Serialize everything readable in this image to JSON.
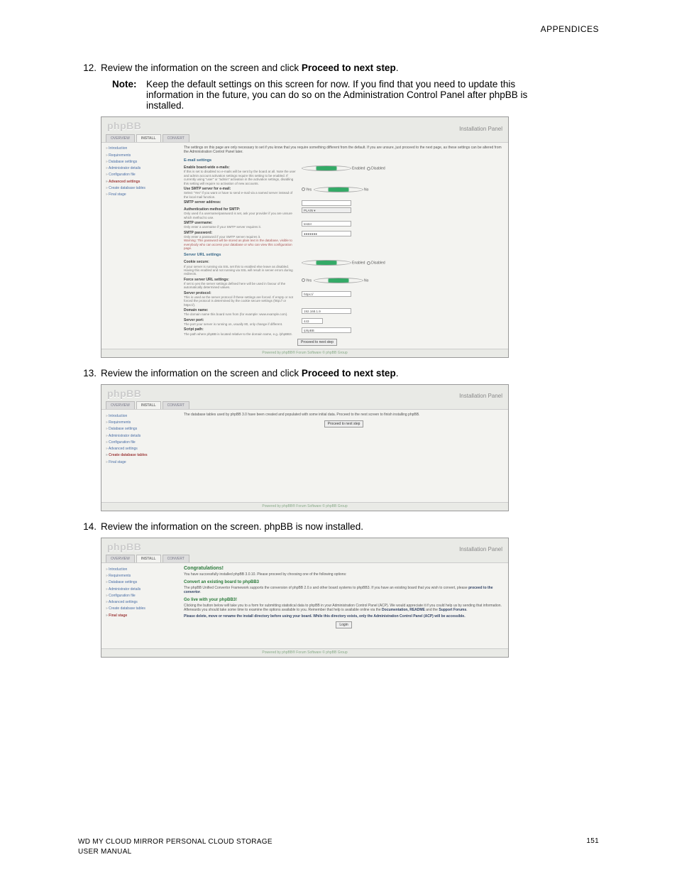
{
  "header": {
    "appendices": "APPENDICES"
  },
  "steps": {
    "s12": {
      "num": "12.",
      "text_a": "Review the information on the screen and click ",
      "bold": "Proceed to next step",
      "text_b": "."
    },
    "note": {
      "label": "Note:",
      "body": "Keep the default settings on this screen for now. If you find that you need to update this information in the future, you can do so on the Administration Control Panel after phpBB is installed."
    },
    "s13": {
      "num": "13.",
      "text_a": "Review the information on the screen and click ",
      "bold": "Proceed to next step",
      "text_b": "."
    },
    "s14": {
      "num": "14.",
      "text": "Review the information on the screen. phpBB is now installed."
    }
  },
  "screenshots": {
    "common": {
      "logo": "phpBB",
      "panel_title": "Installation Panel",
      "tabs": [
        "OVERVIEW",
        "INSTALL",
        "CONVERT"
      ],
      "footer": "Powered by phpBB® Forum Software © phpBB Group"
    },
    "s1": {
      "side": [
        {
          "label": "Introduction"
        },
        {
          "label": "Requirements"
        },
        {
          "label": "Database settings"
        },
        {
          "label": "Administrator details"
        },
        {
          "label": "Configuration file"
        },
        {
          "label": "Advanced settings",
          "active": true
        },
        {
          "label": "Create database tables"
        },
        {
          "label": "Final stage"
        }
      ],
      "intro": "The settings on this page are only necessary to set if you know that you require something different from the default. If you are unsure, just proceed to the next page, as these settings can be altered from the Administration Control Panel later.",
      "email_head": "E-mail settings",
      "fields": {
        "boardwide": {
          "title": "Enable board-wide e-mails:",
          "desc": "If this is set to disabled no e-mails will be sent by the board at all. Note the user and admin account activation settings require this setting to be enabled. If currently using \"user\" or \"admin\" activation in the activation settings, disabling this setting will require no activation of new accounts.",
          "opt1": "Enabled",
          "opt2": "Disabled"
        },
        "usesmtp": {
          "title": "Use SMTP server for e-mail:",
          "desc": "Select \"Yes\" if you want or have to send e-mail via a named server instead of the local mail function.",
          "opt1": "Yes",
          "opt2": "No"
        },
        "smtpaddr": {
          "title": "SMTP server address:",
          "val": ""
        },
        "auth": {
          "title": "Authentication method for SMTP:",
          "desc": "Only used if a username/password is set, ask your provider if you are unsure which method to use.",
          "val": "PLAIN"
        },
        "smtpuser": {
          "title": "SMTP username:",
          "desc": "Only enter a username if your SMTP server requires it.",
          "val": "tester"
        },
        "smtppass": {
          "title": "SMTP password:",
          "desc": "Only enter a password if your SMTP server requires it.",
          "warn": "Warning: This password will be stored as plain text in the database, visible to everybody who can access your database or who can view this configuration page.",
          "val": "●●●●●●●"
        }
      },
      "url_head": "Server URL settings",
      "urlfields": {
        "cookie": {
          "title": "Cookie secure:",
          "desc": "If your server is running via SSL set this to enabled else leave as disabled. Having this enabled and not running via SSL will result in server errors during redirects.",
          "opt1": "Enabled",
          "opt2": "Disabled"
        },
        "force": {
          "title": "Force server URL settings:",
          "desc": "If set to yes the server settings defined here will be used in favour of the automatically determined values.",
          "opt1": "Yes",
          "opt2": "No"
        },
        "proto": {
          "title": "Server protocol:",
          "desc": "This is used as the server protocol if these settings are forced. If empty or not forced the protocol is determined by the cookie secure settings (http:// or https://).",
          "val": "https://"
        },
        "domain": {
          "title": "Domain name:",
          "desc": "The domain name this board runs from (for example: www.example.com).",
          "val": "192.168.1.9"
        },
        "port": {
          "title": "Server port:",
          "desc": "The port your server is running on, usually 80, only change if different.",
          "val": "443"
        },
        "script": {
          "title": "Script path:",
          "desc": "The path where phpBB is located relative to the domain name, e.g. /phpBB3.",
          "val": "/phpBB"
        }
      },
      "proceed": "Proceed to next step"
    },
    "s2": {
      "side": [
        {
          "label": "Introduction"
        },
        {
          "label": "Requirements"
        },
        {
          "label": "Database settings"
        },
        {
          "label": "Administrator details"
        },
        {
          "label": "Configuration file"
        },
        {
          "label": "Advanced settings"
        },
        {
          "label": "Create database tables",
          "active": true
        },
        {
          "label": "Final stage"
        }
      ],
      "msg": "The database tables used by phpBB 3.0 have been created and populated with some initial data. Proceed to the next screen to finish installing phpBB.",
      "proceed": "Proceed to next step"
    },
    "s3": {
      "side": [
        {
          "label": "Introduction"
        },
        {
          "label": "Requirements"
        },
        {
          "label": "Database settings"
        },
        {
          "label": "Administrator details"
        },
        {
          "label": "Configuration file"
        },
        {
          "label": "Advanced settings"
        },
        {
          "label": "Create database tables"
        },
        {
          "label": "Final stage",
          "active": true
        }
      ],
      "congrats_head": "Congratulations!",
      "congrats_body": "You have successfully installed phpBB 3.0.10. Please proceed by choosing one of the following options:",
      "convert_head": "Convert an existing board to phpBB3",
      "convert_body_a": "The phpBB Unified Convertor Framework supports the conversion of phpBB 2.0.x and other board systems to phpBB3. If you have an existing board that you wish to convert, please ",
      "convert_link": "proceed to the convertor",
      "golive_head": "Go live with your phpBB3!",
      "golive_body_a": "Clicking the button below will take you to a form for submitting statistical data to phpBB in your Administration Control Panel (ACP). We would appreciate it if you could help us by sending that information. Afterwards you should take some time to examine the options available to you. Remember that help is available online via the ",
      "golive_link1": "Documentation, README",
      "golive_mid": " and the ",
      "golive_link2": "Support Forums",
      "delete_note": "Please delete, move or rename the install directory before using your board. While this directory exists, only the Administration Control Panel (ACP) will be accessible.",
      "login": "Login"
    }
  },
  "page_footer": {
    "line1": "WD MY CLOUD MIRROR PERSONAL CLOUD STORAGE",
    "line2": "USER MANUAL",
    "page": "151"
  }
}
